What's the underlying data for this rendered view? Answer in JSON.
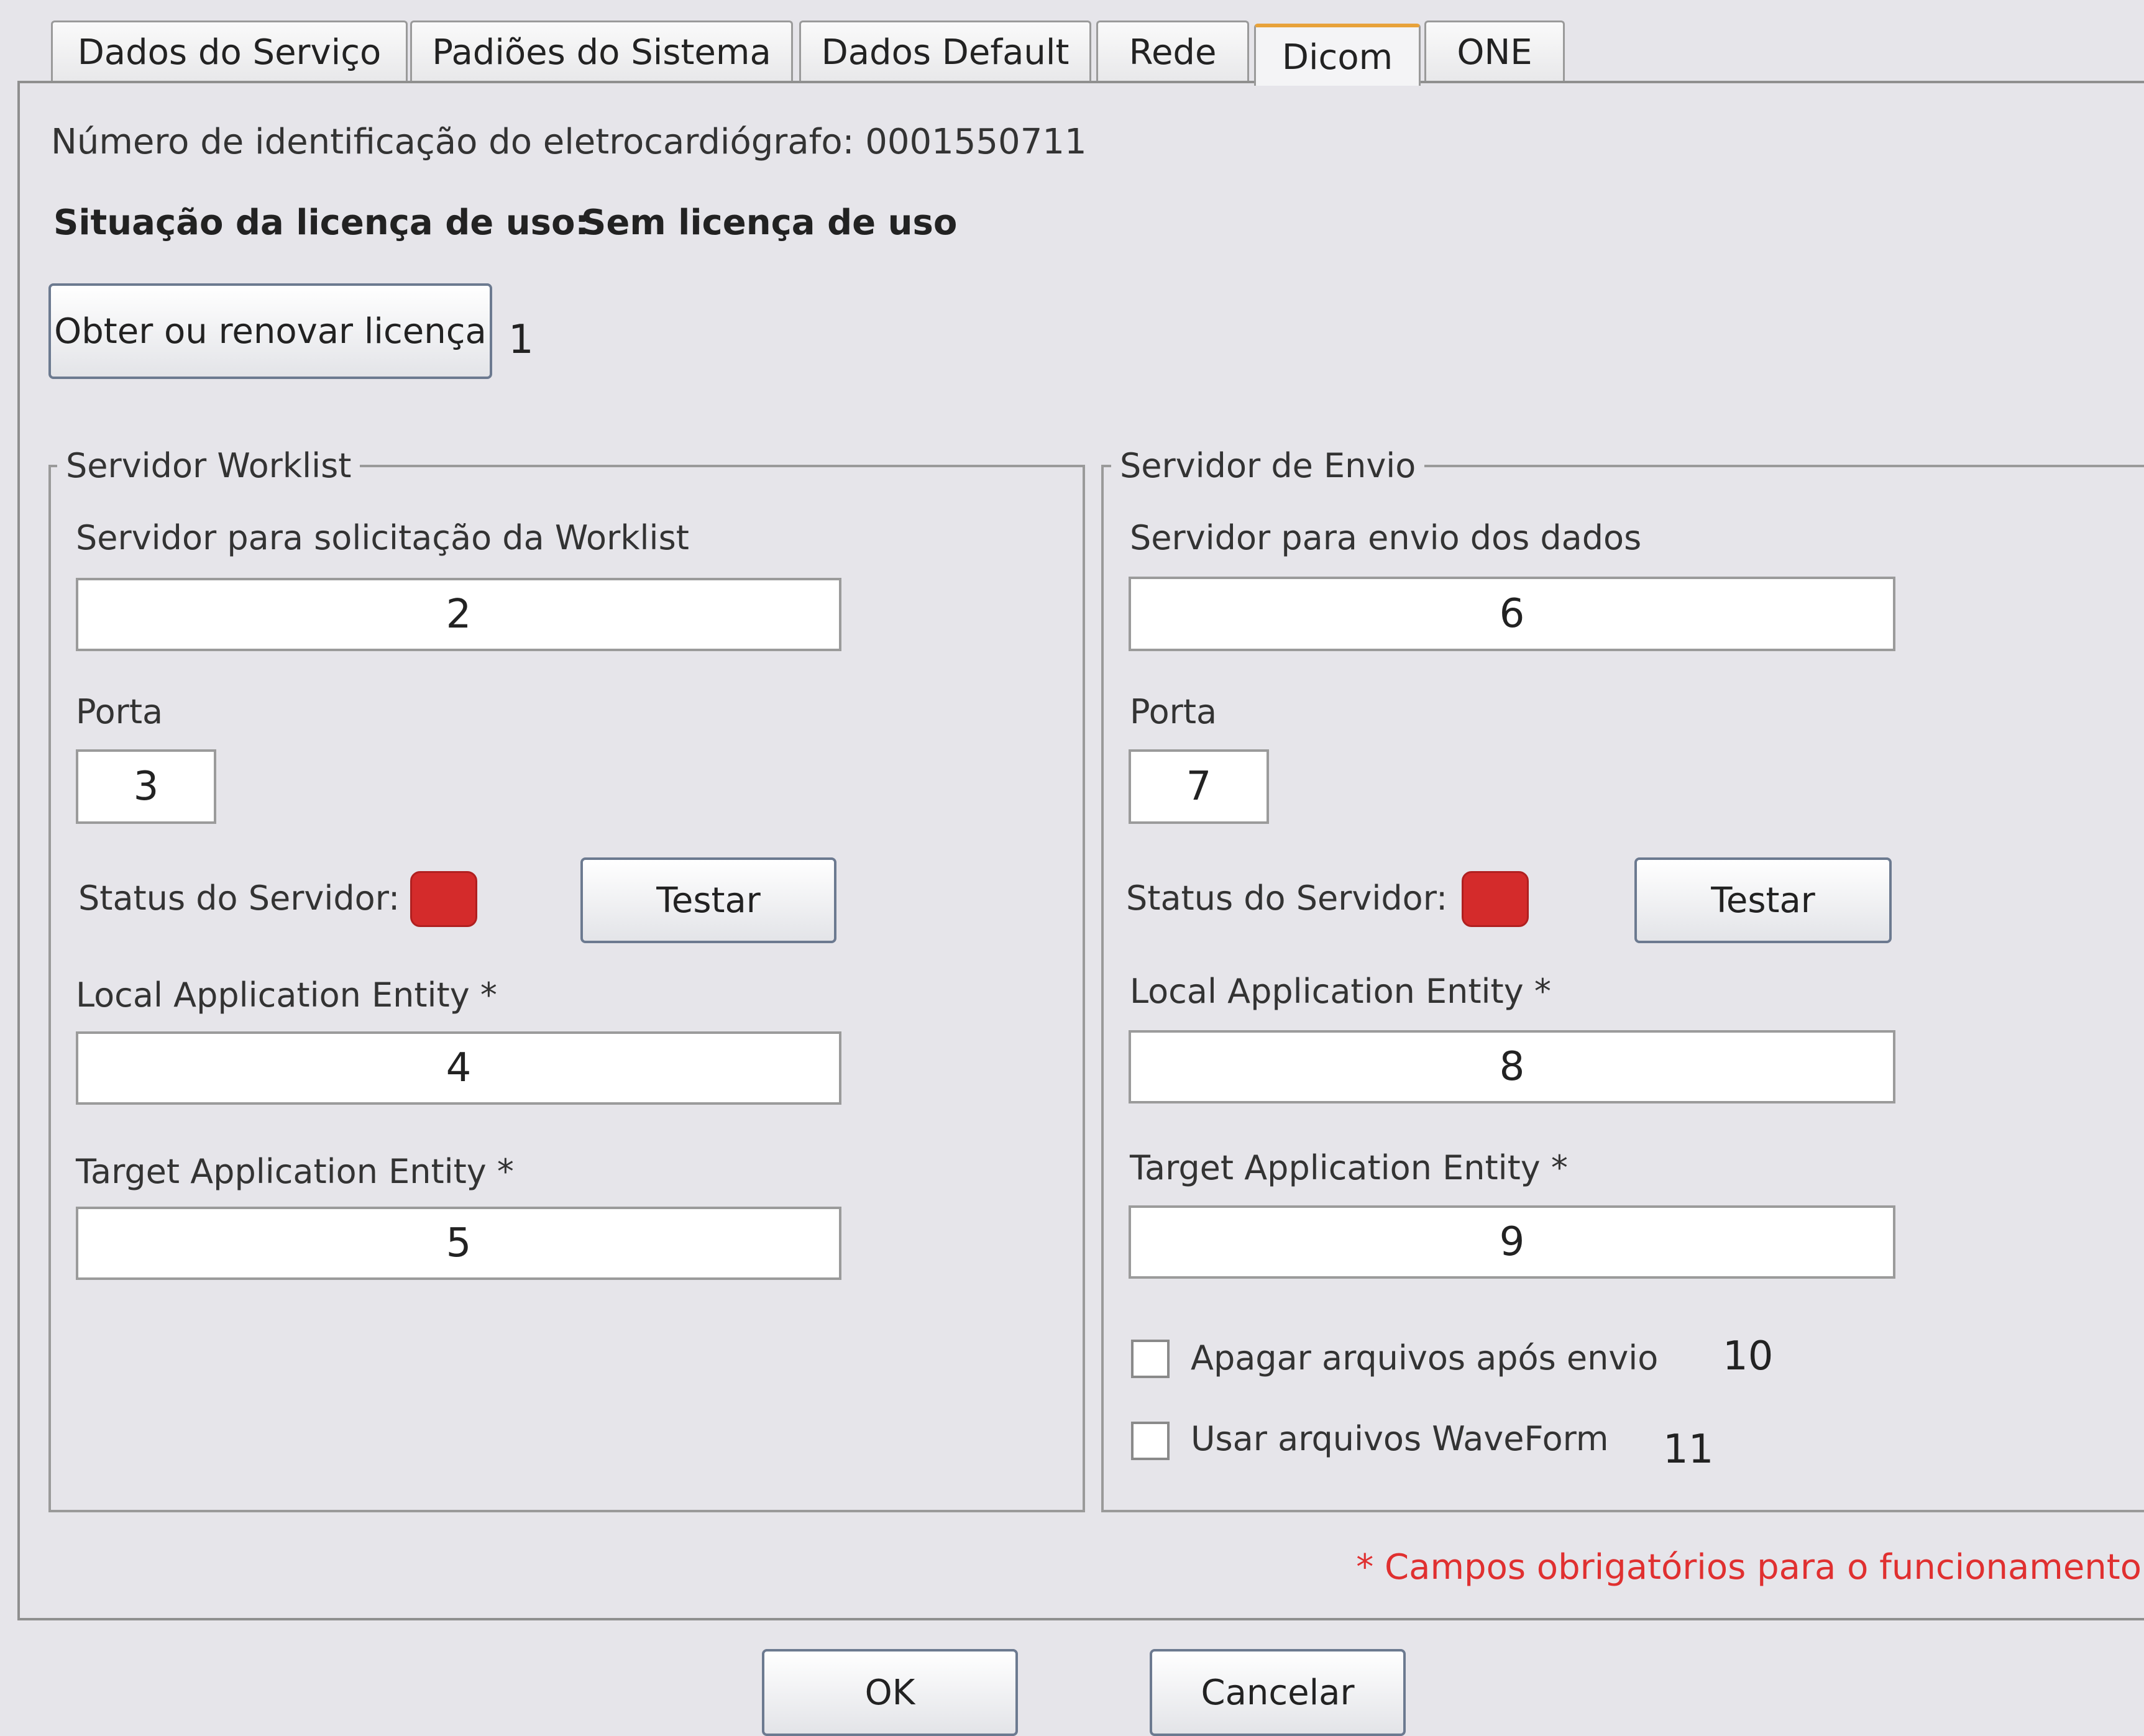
{
  "tabs": [
    {
      "label": "Dados do Serviço"
    },
    {
      "label": "Padiões do Sistema"
    },
    {
      "label": "Dados Default"
    },
    {
      "label": "Rede"
    },
    {
      "label": "Dicom"
    },
    {
      "label": "ONE"
    }
  ],
  "active_tab": "Dicom",
  "device_id": "Número de identificação do eletrocardiógrafo: 0001550711",
  "license": {
    "label": "Situação da licença de uso:",
    "value": "Sem licença de uso",
    "button": "Obter ou renovar licença",
    "callout": "1"
  },
  "worklist": {
    "title": "Servidor Worklist",
    "server_label": "Servidor para solicitação da Worklist",
    "server_value": "2",
    "port_label": "Porta",
    "port_value": "3",
    "status_label": "Status do Servidor:",
    "status_color": "#d42b2b",
    "test_button": "Testar",
    "local_ae_label": "Local Application Entity *",
    "local_ae_value": "4",
    "target_ae_label": "Target Application Entity *",
    "target_ae_value": "5"
  },
  "send": {
    "title": "Servidor de Envio",
    "server_label": "Servidor para envio dos dados",
    "server_value": "6",
    "port_label": "Porta",
    "port_value": "7",
    "status_label": "Status do Servidor:",
    "status_color": "#d42b2b",
    "test_button": "Testar",
    "local_ae_label": "Local Application Entity *",
    "local_ae_value": "8",
    "target_ae_label": "Target Application Entity *",
    "target_ae_value": "9",
    "delete_files_label": "Apagar arquivos após envio",
    "delete_files_callout": "10",
    "waveform_label": "Usar arquivos WaveForm",
    "waveform_callout": "11"
  },
  "required_note": "* Campos obrigatórios para o funcionamento",
  "footer": {
    "ok": "OK",
    "cancel": "Cancelar"
  },
  "colors": {
    "active_tab_accent": "#e8a23a",
    "status_offline": "#d42b2b",
    "required_note": "#e03030"
  }
}
